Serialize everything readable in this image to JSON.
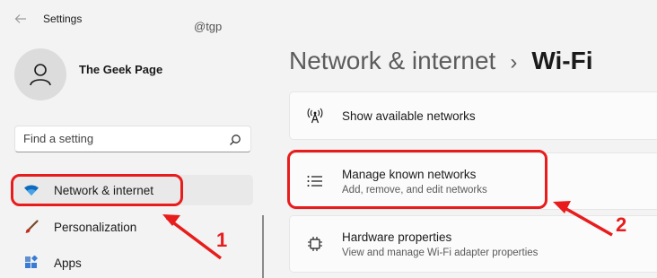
{
  "window": {
    "title": "Settings",
    "watermark": "@tgp"
  },
  "profile": {
    "name": "The Geek Page"
  },
  "search": {
    "placeholder": "Find a setting"
  },
  "sidebar": {
    "items": [
      {
        "label": "Network & internet",
        "icon": "wifi-icon",
        "active": true
      },
      {
        "label": "Personalization",
        "icon": "brush-icon",
        "active": false
      },
      {
        "label": "Apps",
        "icon": "apps-icon",
        "active": false
      }
    ]
  },
  "header": {
    "parent": "Network & internet",
    "separator": "›",
    "current": "Wi-Fi"
  },
  "cards": [
    {
      "title": "Show available networks",
      "subtitle": "",
      "icon": "antenna-icon"
    },
    {
      "title": "Manage known networks",
      "subtitle": "Add, remove, and edit networks",
      "icon": "list-icon"
    },
    {
      "title": "Hardware properties",
      "subtitle": "View and manage Wi-Fi adapter properties",
      "icon": "chip-icon"
    }
  ],
  "annotations": {
    "step1": "1",
    "step2": "2"
  },
  "colors": {
    "annotation_red": "#e81c1c",
    "wifi_blue": "#0f6cbd",
    "brush_red": "#c42b1c"
  }
}
